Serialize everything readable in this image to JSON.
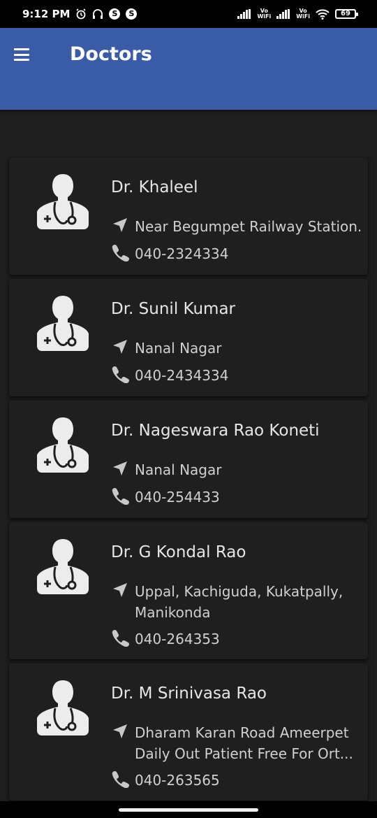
{
  "status_bar": {
    "time": "9:12 PM",
    "vowifi_top": "Vo",
    "vowifi_bottom": "WiFi",
    "battery": "69"
  },
  "app_bar": {
    "title": "Doctors",
    "menu_icon": "hamburger-icon",
    "color": "#3a5ba5"
  },
  "doctors": [
    {
      "name": "Dr. Khaleel",
      "address": "Near Begumpet Railway Station.",
      "phone": "040-2324334"
    },
    {
      "name": "Dr. Sunil Kumar",
      "address": "Nanal Nagar",
      "phone": "040-2434334"
    },
    {
      "name": "Dr. Nageswara Rao Koneti",
      "address": "Nanal Nagar",
      "phone": "040-254433"
    },
    {
      "name": "Dr. G Kondal Rao",
      "address": "Uppal, Kachiguda, Kukatpally, Manikonda",
      "phone": "040-264353"
    },
    {
      "name": "Dr. M Srinivasa Rao",
      "address": "Dharam Karan Road Ameerpet Daily Out Patient Free For Ort...",
      "phone": "040-263565"
    }
  ],
  "icons": {
    "avatar": "doctor-avatar-icon",
    "address": "navigation-arrow-icon",
    "phone": "phone-icon"
  }
}
